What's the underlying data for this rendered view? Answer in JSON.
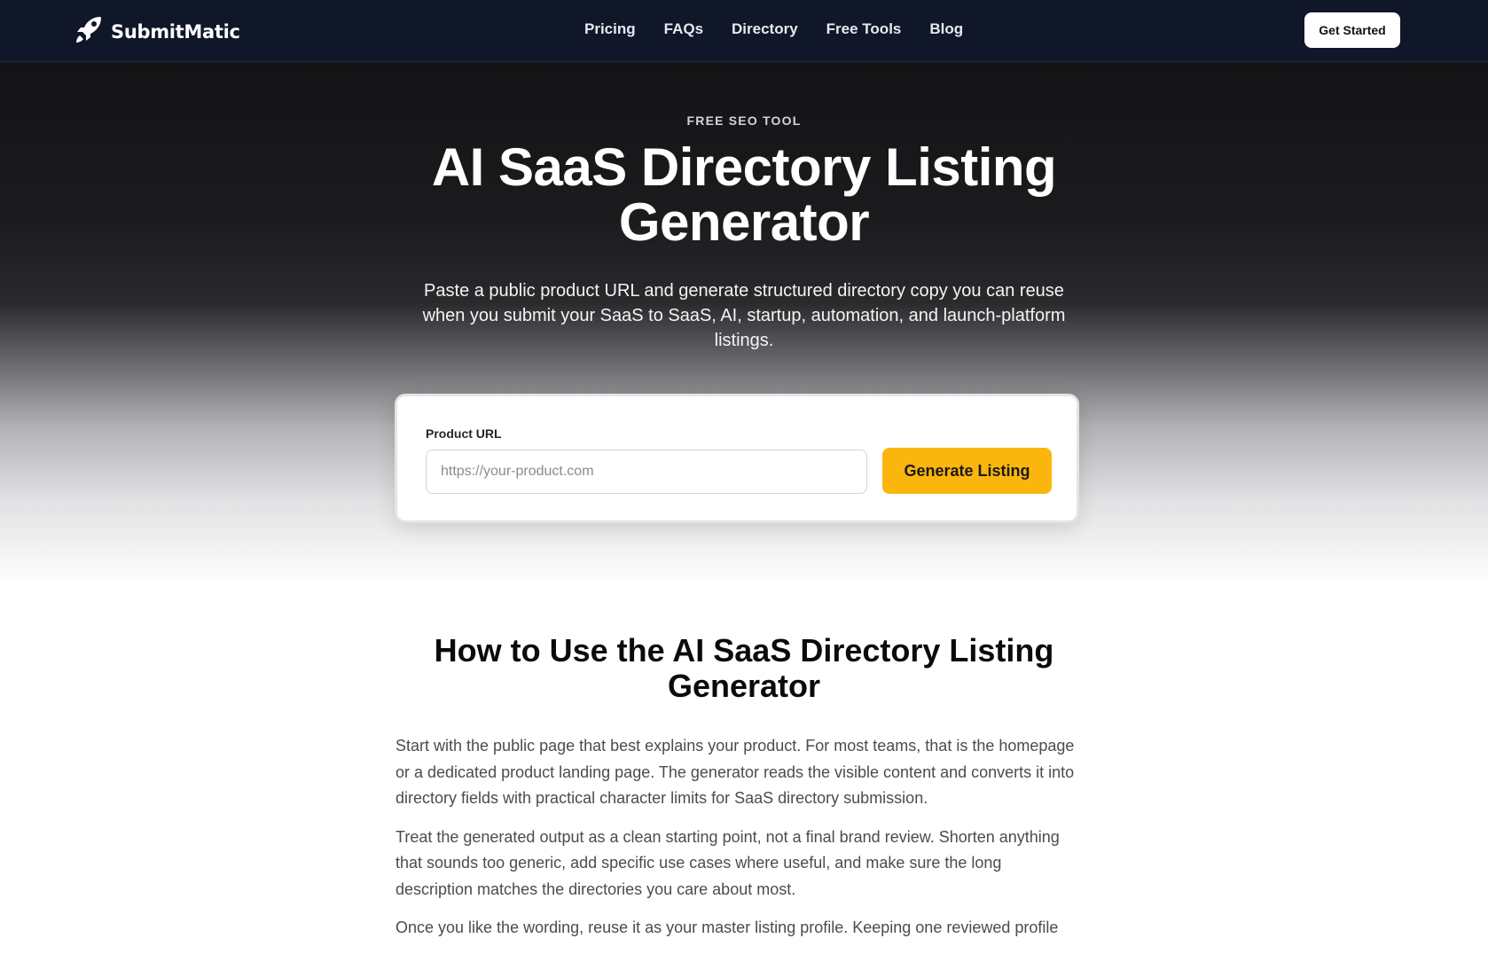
{
  "navbar": {
    "logo_text": "SubmitMatic",
    "logo_icon": "rocket-icon",
    "links": [
      "Pricing",
      "FAQs",
      "Directory",
      "Free Tools",
      "Blog"
    ],
    "cta_label": "Get Started"
  },
  "hero": {
    "eyebrow": "FREE SEO TOOL",
    "title": "AI SaaS Directory Listing Generator",
    "subtitle": "Paste a public product URL and generate structured directory copy you can reuse when you submit your SaaS to SaaS, AI, startup, automation, and launch-platform listings."
  },
  "form": {
    "label": "Product URL",
    "value": "",
    "placeholder": "https://your-product.com",
    "button_label": "Generate Listing"
  },
  "how_to": {
    "title": "How to Use the AI SaaS Directory Listing Generator",
    "paragraphs": [
      "Start with the public page that best explains your product. For most teams, that is the homepage or a dedicated product landing page. The generator reads the visible content and converts it into directory fields with practical character limits for SaaS directory submission.",
      "Treat the generated output as a clean starting point, not a final brand review. Shorten anything that sounds too generic, add specific use cases where useful, and make sure the long description matches the directories you care about most.",
      "Once you like the wording, reuse it as your master listing profile. Keeping one reviewed profile"
    ]
  },
  "colors": {
    "navbar_bg": "#0f1729",
    "accent": "#fbb60d",
    "hero_top": "#141416"
  }
}
